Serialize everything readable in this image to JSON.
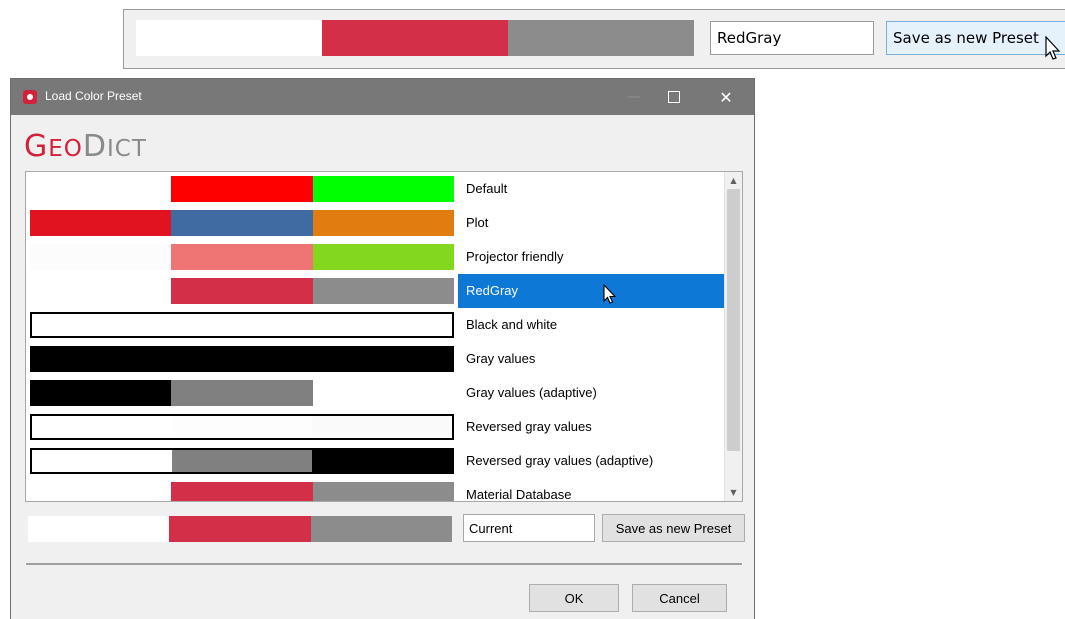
{
  "top_strip": {
    "swatch": [
      "#ffffff",
      "#d32f49",
      "#8c8c8c"
    ],
    "name_value": "RedGray",
    "save_label": "Save as new Preset"
  },
  "dialog": {
    "title": "Load Color Preset",
    "logo": {
      "geo_big": "G",
      "geo_small": "EO",
      "dict_big": "D",
      "dict_small": "ICT"
    },
    "window_buttons": {
      "minimize": "—",
      "close": "✕"
    },
    "presets": [
      {
        "label": "Default",
        "colors": [
          "#ffffff",
          "#ff0000",
          "#00ff00"
        ],
        "outlined": false
      },
      {
        "label": "Plot",
        "colors": [
          "#e11320",
          "#3f6aa2",
          "#e07c10"
        ],
        "outlined": false
      },
      {
        "label": "Projector friendly",
        "colors": [
          "#fcfcfc",
          "#ef7575",
          "#84d71f"
        ],
        "outlined": false
      },
      {
        "label": "RedGray",
        "colors": [
          "#ffffff",
          "#d32f49",
          "#8c8c8c"
        ],
        "outlined": false,
        "selected": true
      },
      {
        "label": "Black and white",
        "colors": [
          "#ffffff",
          "#ffffff",
          "#ffffff"
        ],
        "outlined": true
      },
      {
        "label": "Gray values",
        "colors": [
          "#000000",
          "#000000",
          "#000000"
        ],
        "outlined": false
      },
      {
        "label": "Gray values (adaptive)",
        "colors": [
          "#000000",
          "#808080",
          "#ffffff"
        ],
        "outlined": false
      },
      {
        "label": "Reversed gray values",
        "colors": [
          "#ffffff",
          "#fdfdfd",
          "#fafafa"
        ],
        "outlined": true
      },
      {
        "label": "Reversed gray values (adaptive)",
        "colors": [
          "#ffffff",
          "#808080",
          "#000000"
        ],
        "outlined": true
      },
      {
        "label": "Material Database",
        "colors": [
          "#ffffff",
          "#d32f49",
          "#8c8c8c"
        ],
        "outlined": false
      }
    ],
    "current": {
      "colors": [
        "#ffffff",
        "#d32f49",
        "#8c8c8c"
      ],
      "name_value": "Current",
      "save_label": "Save as new Preset"
    },
    "ok_label": "OK",
    "cancel_label": "Cancel"
  },
  "colors": {
    "accent": "#0e78d7",
    "brand": "#d3213c",
    "titlebar": "#787878"
  }
}
